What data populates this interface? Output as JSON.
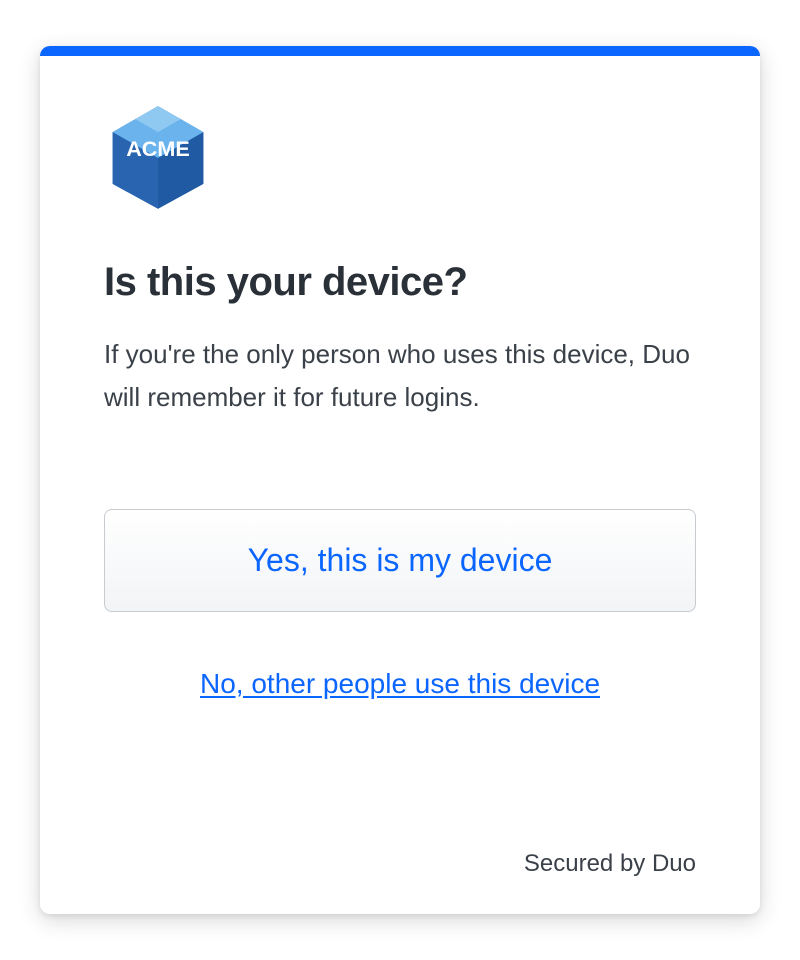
{
  "brand": {
    "logo_name": "ACME",
    "accent_color": "#0b66ff"
  },
  "prompt": {
    "title": "Is this your device?",
    "description": "If you're the only person who uses this device, Duo will remember it for future logins."
  },
  "actions": {
    "primary_label": "Yes, this is my device",
    "secondary_label": "No, other people use this device"
  },
  "footer": {
    "secured_by": "Secured by Duo"
  }
}
